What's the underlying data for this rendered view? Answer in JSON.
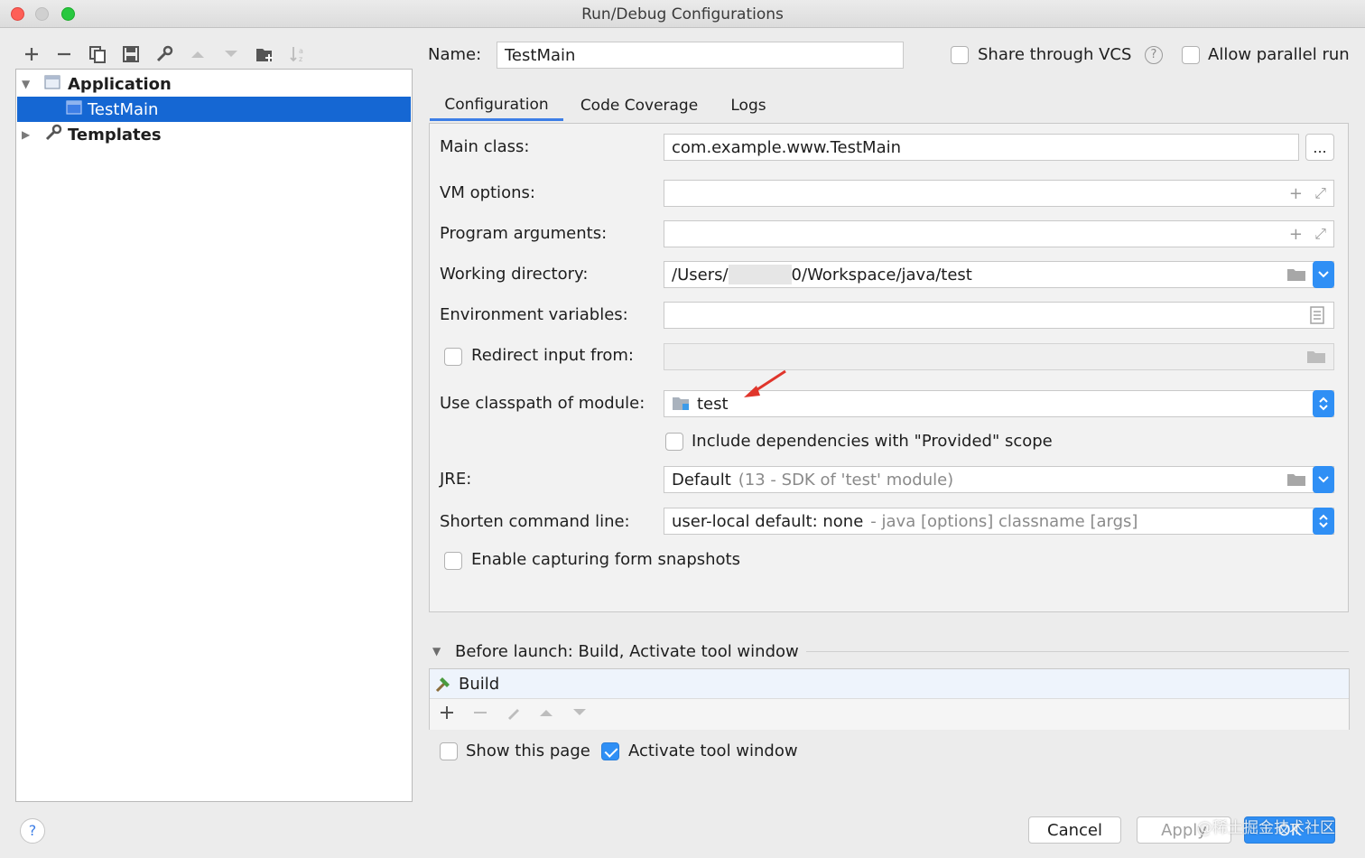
{
  "window": {
    "title": "Run/Debug Configurations"
  },
  "toolbar": {
    "icons": [
      "plus-icon",
      "minus-icon",
      "copy-icon",
      "save-icon",
      "wrench-icon",
      "arrow-up-icon",
      "arrow-down-icon",
      "new-folder-icon",
      "sort-icon"
    ]
  },
  "tree": {
    "items": [
      {
        "label": "Application",
        "expanded": true
      },
      {
        "label": "TestMain",
        "selected": true
      },
      {
        "label": "Templates",
        "expanded": false
      }
    ]
  },
  "header": {
    "name_label": "Name:",
    "name_value": "TestMain",
    "share_vcs": "Share through VCS",
    "allow_parallel": "Allow parallel run"
  },
  "tabs": [
    {
      "label": "Configuration",
      "active": true
    },
    {
      "label": "Code Coverage"
    },
    {
      "label": "Logs"
    }
  ],
  "form": {
    "main_class_label": "Main class:",
    "main_class_value": "com.example.www.TestMain",
    "main_class_browse": "...",
    "vm_options_label": "VM options:",
    "program_args_label": "Program arguments:",
    "working_dir_label": "Working directory:",
    "working_dir_prefix": "/Users/",
    "working_dir_suffix": "0/Workspace/java/test",
    "env_vars_label": "Environment variables:",
    "redirect_label": "Redirect input from:",
    "classpath_label": "Use classpath of module:",
    "classpath_value": "test",
    "include_deps": "Include dependencies with \"Provided\" scope",
    "jre_label": "JRE:",
    "jre_value": "Default",
    "jre_hint": "(13 - SDK of 'test' module)",
    "shorten_label": "Shorten command line:",
    "shorten_value": "user-local default: none",
    "shorten_hint": "- java [options] classname [args]",
    "snapshots": "Enable capturing form snapshots"
  },
  "before_launch": {
    "title": "Before launch: Build, Activate tool window",
    "task": "Build",
    "show_page": "Show this page",
    "activate_window": "Activate tool window",
    "show_page_checked": false,
    "activate_checked": true
  },
  "footer": {
    "help": "?",
    "cancel": "Cancel",
    "apply": "Apply",
    "ok": "OK",
    "watermark": "@稀土掘金技术社区"
  },
  "colors": {
    "accent": "#2f8ff5",
    "selection": "#1567d3",
    "arrow": "#e0352b"
  }
}
